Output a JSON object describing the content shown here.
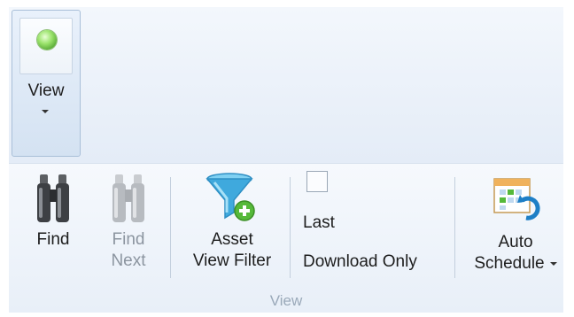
{
  "ribbon": {
    "view_button": {
      "label": "View",
      "icon": "green-dot-icon"
    },
    "find": {
      "label": "Find",
      "icon": "binoculars-icon"
    },
    "find_next": {
      "line1": "Find",
      "line2": "Next",
      "icon": "binoculars-disabled-icon",
      "enabled": false
    },
    "asset_view_filter": {
      "line1": "Asset",
      "line2": "View Filter",
      "icon": "funnel-add-icon"
    },
    "last_download_only": {
      "line1": "Last",
      "line2": "Download Only",
      "checked": false
    },
    "auto_schedule": {
      "line1": "Auto",
      "line2": "Schedule",
      "icon": "calendar-schedule-icon"
    },
    "group_label": "View"
  },
  "colors": {
    "ribbon_bg": "#e6eef8",
    "funnel": "#3fa9dd",
    "green": "#56b93a",
    "disabled_text": "#8c95a0"
  }
}
